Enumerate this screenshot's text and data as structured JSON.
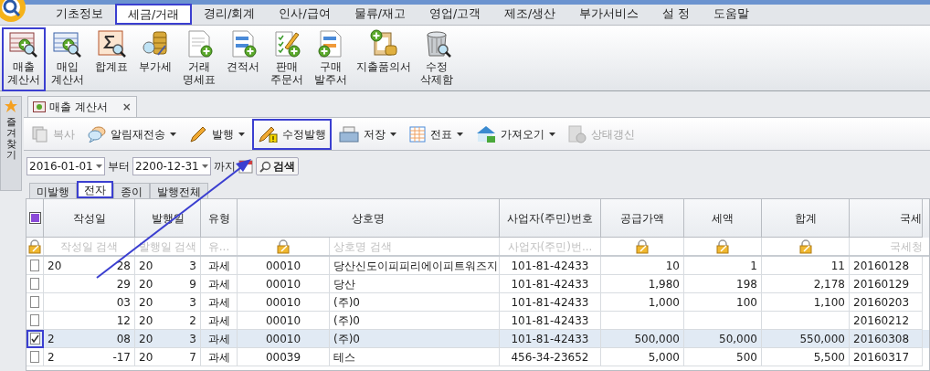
{
  "menu_tabs": [
    {
      "label": "기초정보",
      "selected": false,
      "highlighted": false
    },
    {
      "label": "세금/거래",
      "selected": true,
      "highlighted": true
    },
    {
      "label": "경리/회계",
      "selected": false,
      "highlighted": false
    },
    {
      "label": "인사/급여",
      "selected": false,
      "highlighted": false
    },
    {
      "label": "물류/재고",
      "selected": false,
      "highlighted": false
    },
    {
      "label": "영업/고객",
      "selected": false,
      "highlighted": false
    },
    {
      "label": "제조/생산",
      "selected": false,
      "highlighted": false
    },
    {
      "label": "부가서비스",
      "selected": false,
      "highlighted": false
    },
    {
      "label": "설 정",
      "selected": false,
      "highlighted": false
    },
    {
      "label": "도움말",
      "selected": false,
      "highlighted": false
    }
  ],
  "ribbon": [
    {
      "lines": [
        "매출",
        "계산서"
      ],
      "highlighted": true
    },
    {
      "lines": [
        "매입",
        "계산서"
      ],
      "highlighted": false
    },
    {
      "lines": [
        "합계표"
      ],
      "highlighted": false
    },
    {
      "lines": [
        "부가세"
      ],
      "highlighted": false
    },
    {
      "lines": [
        "거래",
        "명세표"
      ],
      "highlighted": false
    },
    {
      "lines": [
        "견적서"
      ],
      "highlighted": false
    },
    {
      "lines": [
        "판매",
        "주문서"
      ],
      "highlighted": false
    },
    {
      "lines": [
        "구매",
        "발주서"
      ],
      "highlighted": false
    },
    {
      "lines": [
        "지출품의서"
      ],
      "highlighted": false
    },
    {
      "lines": [
        "수정",
        "삭제함"
      ],
      "highlighted": false
    }
  ],
  "side_panel": {
    "label": "즐겨찾기"
  },
  "document_tab": {
    "title": "매출 계산서",
    "close": "×"
  },
  "toolbar": [
    {
      "label": "복사",
      "disabled": true,
      "dropdown": false,
      "highlighted": false
    },
    {
      "label": "알림재전송",
      "disabled": false,
      "dropdown": true,
      "highlighted": false
    },
    {
      "label": "발행",
      "disabled": false,
      "dropdown": true,
      "highlighted": false
    },
    {
      "label": "수정발행",
      "disabled": false,
      "dropdown": false,
      "highlighted": true
    },
    {
      "label": "저장",
      "disabled": false,
      "dropdown": true,
      "highlighted": false
    },
    {
      "label": "전표",
      "disabled": false,
      "dropdown": true,
      "highlighted": false
    },
    {
      "label": "가져오기",
      "disabled": false,
      "dropdown": true,
      "highlighted": false
    },
    {
      "label": "상태갱신",
      "disabled": true,
      "dropdown": false,
      "highlighted": false
    }
  ],
  "date_filter": {
    "from": "2016-01-01",
    "from_label": "부터",
    "to": "2200-12-31",
    "to_label": "까지",
    "search_button": "검색"
  },
  "sub_tabs": [
    {
      "label": "미발행",
      "selected": false,
      "highlighted": false
    },
    {
      "label": "전자",
      "selected": true,
      "highlighted": true
    },
    {
      "label": "종이",
      "selected": false,
      "highlighted": false
    },
    {
      "label": "발행전체",
      "selected": false,
      "highlighted": false
    }
  ],
  "table": {
    "columns": [
      "작성일",
      "발행일",
      "유형",
      "상호명",
      "사업자(주민)번호",
      "공급가액",
      "세액",
      "합계",
      "국세"
    ],
    "filters": [
      "작성일 검색",
      "발행일 검색",
      "유...",
      "상호명 검색",
      "사업자(주민)번... ",
      "국세청"
    ],
    "select_all": {
      "partial": true
    },
    "rows": [
      {
        "checked": false,
        "selected": false,
        "written_a": "20",
        "written_b": "28",
        "issued_a": "20",
        "issued_b": "3",
        "type": "과세",
        "code": "00010",
        "name": "당산신도이피피리에이피트워즈지",
        "biz_no": "101-81-42433",
        "supply": "10",
        "tax": "1",
        "total": "11",
        "nts": "20160128"
      },
      {
        "checked": false,
        "selected": false,
        "written_b": "29",
        "issued_a": "20",
        "issued_b": "9",
        "type": "과세",
        "code": "00010",
        "name": "당산",
        "biz_no": "101-81-42433",
        "supply": "1,980",
        "tax": "198",
        "total": "2,178",
        "nts": "20160129"
      },
      {
        "checked": false,
        "selected": false,
        "written_b": "03",
        "issued_a": "20",
        "issued_b": "3",
        "type": "과세",
        "code": "00010",
        "name": "(주)0",
        "biz_no": "101-81-42433",
        "supply": "1,000",
        "tax": "100",
        "total": "1,100",
        "nts": "20160203"
      },
      {
        "checked": false,
        "selected": false,
        "written_b": "12",
        "issued_a": "20",
        "issued_b": "2",
        "type": "과세",
        "code": "00010",
        "name": "(주)0",
        "biz_no": "101-81-42433",
        "nts": "20160212"
      },
      {
        "checked": true,
        "selected": true,
        "written_a": "2",
        "written_b": "08",
        "issued_a": "20",
        "issued_b": "3",
        "type": "과세",
        "code": "00010",
        "name": "(주)0",
        "biz_no": "101-81-42433",
        "supply": "500,000",
        "tax": "50,000",
        "total": "550,000",
        "nts": "20160308"
      },
      {
        "checked": false,
        "selected": false,
        "written_a": "2",
        "written_b": "-17",
        "issued_a": "20",
        "issued_b": "7",
        "type": "과세",
        "code": "00039",
        "name": "테스",
        "biz_no": "456-34-23652",
        "supply": "5,000",
        "tax": "500",
        "total": "5,500",
        "nts": "20160317"
      }
    ]
  }
}
